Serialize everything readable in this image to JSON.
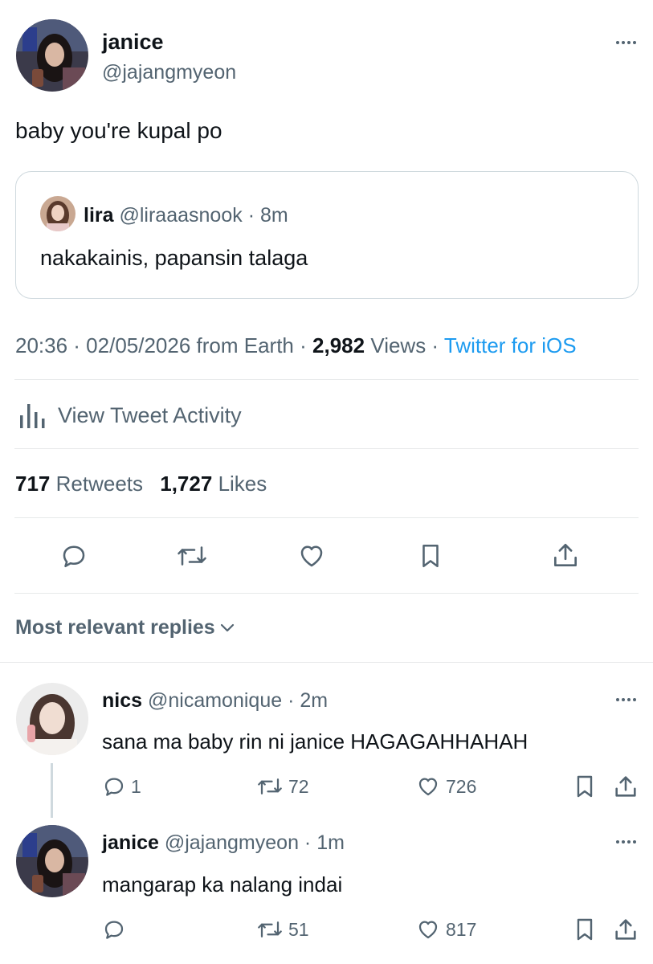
{
  "tweet": {
    "author_name": "janice",
    "author_handle": "@jajangmyeon",
    "text": "baby you're kupal po",
    "quote": {
      "name": "lira",
      "handle": "@liraaasnook",
      "time": "· 8m",
      "text": "nakakainis, papansin talaga"
    },
    "meta": {
      "time_date": "20:36 · 02/05/2026 from Earth ·",
      "views_count": "2,982",
      "views_label": "Views ·",
      "source": "Twitter for iOS"
    },
    "activity_label": "View Tweet Activity",
    "retweets_count": "717",
    "retweets_label": "Retweets",
    "likes_count": "1,727",
    "likes_label": "Likes"
  },
  "replies_filter": "Most relevant replies",
  "replies": [
    {
      "name": "nics",
      "handle": "@nicamonique",
      "time": "· 2m",
      "text": "sana ma baby rin ni janice HAGAGAHHAHAH",
      "reply_count": "1",
      "retweet_count": "72",
      "like_count": "726"
    },
    {
      "name": "janice",
      "handle": "@jajangmyeon",
      "time": "· 1m",
      "text": "mangarap ka nalang indai",
      "reply_count": "",
      "retweet_count": "51",
      "like_count": "817"
    }
  ],
  "colors": {
    "link": "#1d9bf0",
    "text": "#0f1419",
    "muted": "#536471",
    "divider": "#e7e9ea"
  },
  "icons": [
    "more-icon",
    "analytics-icon",
    "reply-icon",
    "retweet-icon",
    "like-icon",
    "bookmark-icon",
    "share-icon",
    "chevron-down-icon"
  ]
}
